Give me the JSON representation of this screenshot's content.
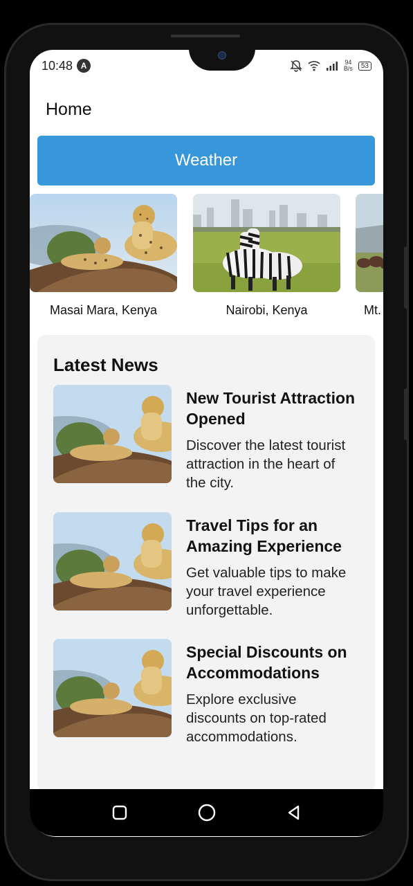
{
  "status_bar": {
    "time": "10:48",
    "app_badge": "A",
    "net_speed_value": "94",
    "net_speed_unit": "B/s",
    "battery": "53",
    "icons": [
      "mute-bell-icon",
      "wifi-icon",
      "signal-icon",
      "battery-icon"
    ]
  },
  "appbar": {
    "title": "Home"
  },
  "weather_button": {
    "label": "Weather",
    "color": "#3897db"
  },
  "places": [
    {
      "caption": "Masai Mara, Kenya",
      "image": "cheetahs-photo"
    },
    {
      "caption": "Nairobi, Kenya",
      "image": "zebras-photo"
    },
    {
      "caption": "Mt.",
      "image": "wildlife-photo"
    }
  ],
  "news": {
    "heading": "Latest News",
    "items": [
      {
        "title_line1": "New Tourist Attraction",
        "title_line2": "Opened",
        "desc_line1": "Discover the latest tourist",
        "desc_line2": "attraction in the heart of",
        "desc_line3": "the city."
      },
      {
        "title_line1": "Travel Tips for an",
        "title_line2": "Amazing Experience",
        "desc_line1": "Get valuable tips to make",
        "desc_line2": "your travel experience",
        "desc_line3": "unforgettable."
      },
      {
        "title_line1": "Special Discounts on",
        "title_line2": "Accommodations",
        "desc_line1": "Explore exclusive",
        "desc_line2": "discounts on top-rated",
        "desc_line3": "accommodations."
      }
    ]
  },
  "nav_bar": {
    "buttons": [
      "square-icon",
      "circle-icon",
      "back-triangle-icon"
    ]
  }
}
